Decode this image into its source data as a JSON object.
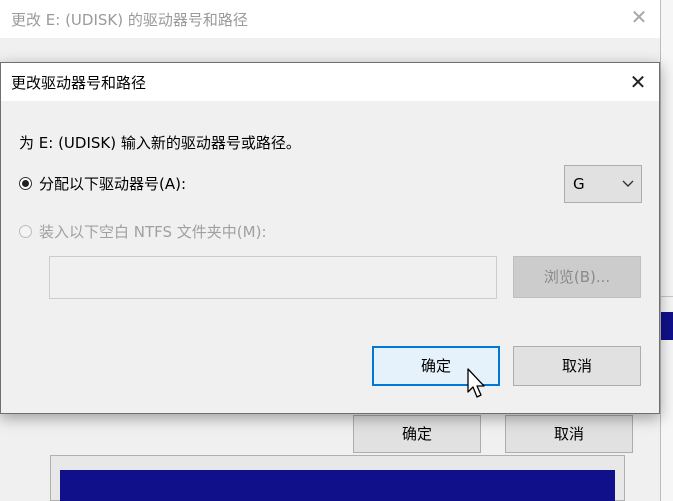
{
  "parent_dialog": {
    "title": "更改 E: (UDISK) 的驱动器号和路径",
    "close_glyph": "✕",
    "ok_label": "确定",
    "cancel_label": "取消"
  },
  "dialog": {
    "title": "更改驱动器号和路径",
    "close_glyph": "✕",
    "prompt": "为 E: (UDISK) 输入新的驱动器号或路径。",
    "assign_letter_label": "分配以下驱动器号(A):",
    "assign_letter_selected": true,
    "mount_folder_label": "装入以下空白 NTFS 文件夹中(M):",
    "mount_folder_selected": false,
    "drive_letter": "G",
    "path_value": "",
    "browse_label": "浏览(B)...",
    "ok_label": "确定",
    "cancel_label": "取消"
  },
  "icons": {
    "close": "close-icon",
    "dropdown": "chevron-down-icon",
    "cursor": "mouse-pointer-icon"
  },
  "colors": {
    "accent": "#0078d7",
    "selection_blue": "#10108a"
  }
}
